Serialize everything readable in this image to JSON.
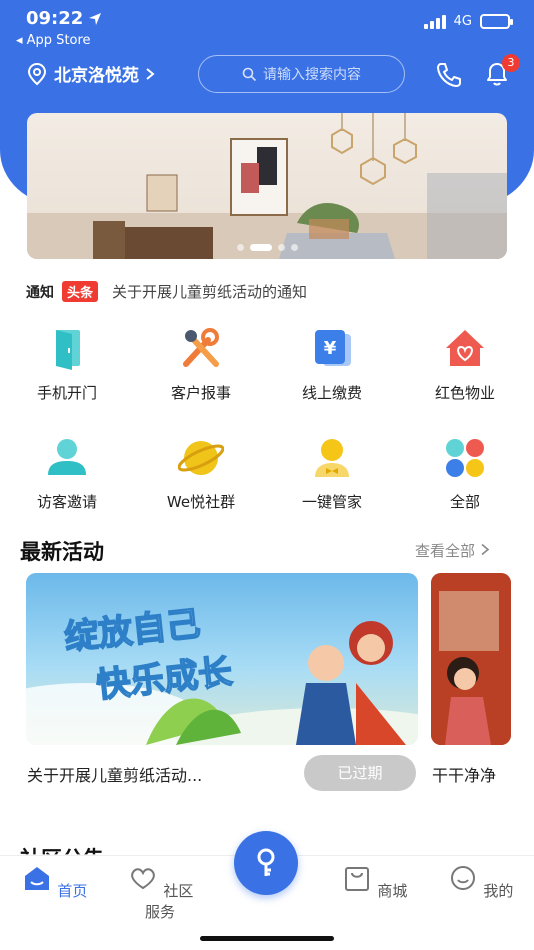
{
  "status_bar": {
    "time": "09:22",
    "back_app": "◂ App Store",
    "network": "4G"
  },
  "header": {
    "location": "北京洛悦苑",
    "search_placeholder": "请输入搜索内容",
    "notification_count": "3",
    "accent_color": "#3a72e6"
  },
  "banner": {
    "slides": 4,
    "active_slide": 2
  },
  "notice": {
    "label": "通知",
    "tag": "头条",
    "text": "关于开展儿童剪纸活动的通知"
  },
  "services": [
    {
      "label": "手机开门",
      "icon": "door-icon"
    },
    {
      "label": "客户报事",
      "icon": "tools-icon"
    },
    {
      "label": "线上缴费",
      "icon": "yuan-payment-icon"
    },
    {
      "label": "红色物业",
      "icon": "red-house-heart-icon"
    },
    {
      "label": "访客邀请",
      "icon": "visitor-icon"
    },
    {
      "label": "We悦社群",
      "icon": "planet-icon"
    },
    {
      "label": "一键管家",
      "icon": "butler-icon"
    },
    {
      "label": "全部",
      "icon": "all-apps-icon"
    }
  ],
  "activities": {
    "title": "最新活动",
    "see_all": "查看全部",
    "items": [
      {
        "title": "关于开展儿童剪纸活动...",
        "status": "已过期",
        "image_text_1": "绽放自己",
        "image_text_2": "快乐成长"
      },
      {
        "title": "干干净净"
      }
    ]
  },
  "tabbar": {
    "items": [
      {
        "label": "首页",
        "icon": "home-icon",
        "active": true
      },
      {
        "label": "社区服务",
        "icon": "heart-hand-icon"
      },
      {
        "label": "商城",
        "icon": "shopping-bag-icon"
      },
      {
        "label": "我的",
        "icon": "smile-icon"
      }
    ],
    "center_icon": "key-icon"
  },
  "next_section_title": "社区公告"
}
